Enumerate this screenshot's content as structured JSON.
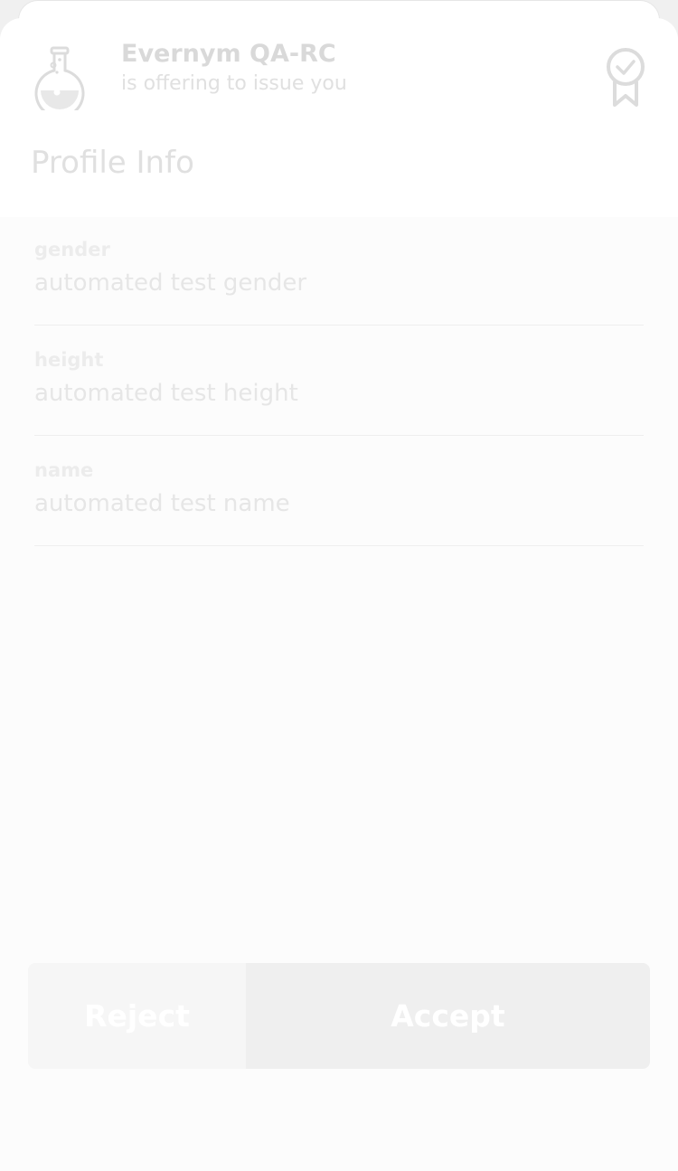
{
  "issuer": {
    "name": "Evernym QA-RC",
    "subtitle": "is offering to issue you",
    "logo_icon": "flask-icon"
  },
  "credential": {
    "title": "Profile Info",
    "badge_icon": "award-ribbon-icon"
  },
  "attributes": [
    {
      "label": "gender",
      "value": "automated test gender"
    },
    {
      "label": "height",
      "value": "automated test height"
    },
    {
      "label": "name",
      "value": "automated test name"
    }
  ],
  "actions": {
    "reject_label": "Reject",
    "accept_label": "Accept"
  },
  "colors": {
    "modal_background": "#fcfcfc",
    "header_background": "#ffffff",
    "reject_button": "#f6f6f6",
    "accept_button": "#efefef"
  }
}
